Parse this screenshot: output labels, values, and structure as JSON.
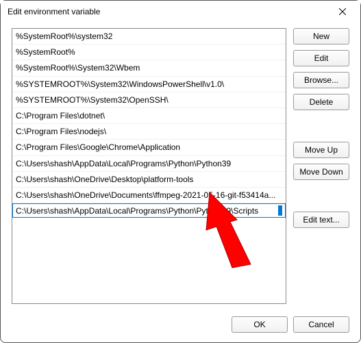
{
  "window": {
    "title": "Edit environment variable"
  },
  "list": {
    "items": [
      "%SystemRoot%\\system32",
      "%SystemRoot%",
      "%SystemRoot%\\System32\\Wbem",
      "%SYSTEMROOT%\\System32\\WindowsPowerShell\\v1.0\\",
      "%SYSTEMROOT%\\System32\\OpenSSH\\",
      "C:\\Program Files\\dotnet\\",
      "C:\\Program Files\\nodejs\\",
      "C:\\Program Files\\Google\\Chrome\\Application",
      "C:\\Users\\shash\\AppData\\Local\\Programs\\Python\\Python39",
      "C:\\Users\\shash\\OneDrive\\Desktop\\platform-tools",
      "C:\\Users\\shash\\OneDrive\\Documents\\ffmpeg-2021-05-16-git-f53414a..."
    ],
    "editing_value": "C:\\Users\\shash\\AppData\\Local\\Programs\\Python\\Python39\\Scripts"
  },
  "buttons": {
    "new": "New",
    "edit": "Edit",
    "browse": "Browse...",
    "delete": "Delete",
    "move_up": "Move Up",
    "move_down": "Move Down",
    "edit_text": "Edit text...",
    "ok": "OK",
    "cancel": "Cancel"
  }
}
